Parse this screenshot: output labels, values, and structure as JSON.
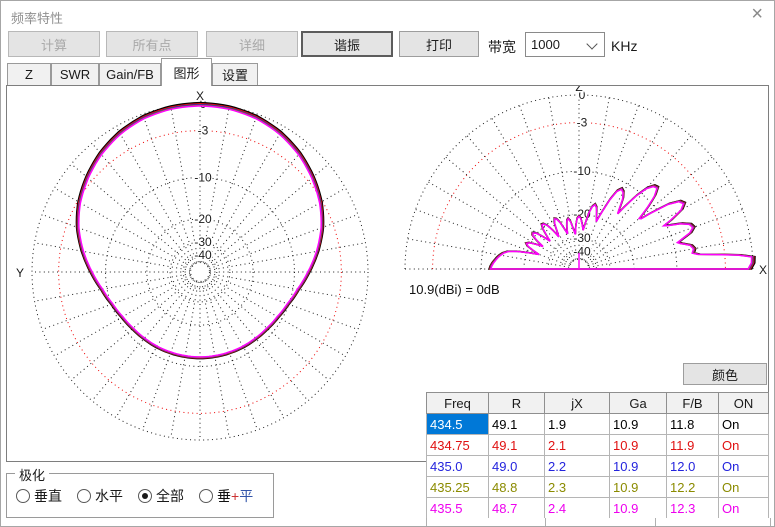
{
  "window": {
    "title": "频率特性",
    "close_icon": "×"
  },
  "toolbar": {
    "buttons": [
      {
        "label": "计算",
        "enabled": false
      },
      {
        "label": "所有点",
        "enabled": false
      },
      {
        "label": "详细",
        "enabled": false
      },
      {
        "label": "谐振",
        "enabled": true,
        "emphasized": true
      },
      {
        "label": "打印",
        "enabled": true
      }
    ],
    "bandwidth": {
      "label": "带宽",
      "value": "1000",
      "unit": "KHz"
    }
  },
  "tabs": {
    "items": [
      "Z",
      "SWR",
      "Gain/FB",
      "图形",
      "设置"
    ],
    "active": "图形"
  },
  "charts": {
    "gain_ref_note": "10.9(dBi) = 0dB",
    "trace_colors": [
      "#000000",
      "#dd1111",
      "#2424cc",
      "#8b8b00",
      "#ff00ff"
    ],
    "trace_db_offsets": [
      0.34,
      0.22,
      0.12,
      0.05,
      0
    ],
    "grid": {
      "ring_dbs": [
        0,
        -3,
        -10,
        -20,
        -30,
        -40,
        -50
      ],
      "labeled_dbs": [
        0,
        -3,
        -10,
        -20,
        -30,
        -40
      ],
      "ring_labels": [
        "0",
        "-3",
        "-10",
        "-20",
        "-30",
        "-40"
      ],
      "highlight_db": -3,
      "ring_color": "#1a1a1a",
      "highlight_ring_color": "#ee0000",
      "spoke_step_deg": 10
    },
    "azimuth": {
      "axis_top_label": "X",
      "axis_left_label": "Y",
      "samples_deg_db": [
        [
          0,
          -0.2
        ],
        [
          10,
          -0.28
        ],
        [
          20,
          -0.5
        ],
        [
          30,
          -0.95
        ],
        [
          40,
          -1.6
        ],
        [
          50,
          -2.45
        ],
        [
          60,
          -3.4
        ],
        [
          70,
          -4.6
        ],
        [
          80,
          -6.1
        ],
        [
          90,
          -7.7
        ],
        [
          100,
          -9.2
        ],
        [
          110,
          -10.3
        ],
        [
          120,
          -11.0
        ],
        [
          130,
          -11.4
        ],
        [
          140,
          -11.6
        ],
        [
          150,
          -11.7
        ],
        [
          160,
          -11.8
        ],
        [
          170,
          -11.85
        ],
        [
          180,
          -11.85
        ]
      ]
    },
    "elevation": {
      "axis_top_label": "Z",
      "axis_right_label": "X",
      "samples_deg_db": [
        [
          0,
          -0.5
        ],
        [
          2,
          -0.15
        ],
        [
          4,
          -0.1
        ],
        [
          5,
          -1.5
        ],
        [
          6,
          -4
        ],
        [
          7,
          -6.5
        ],
        [
          8,
          -7.3
        ],
        [
          10,
          -7.0
        ],
        [
          12,
          -7.4
        ],
        [
          14,
          -8.8
        ],
        [
          15,
          -9.3
        ],
        [
          16,
          -8.6
        ],
        [
          18,
          -7.0
        ],
        [
          20,
          -6.3
        ],
        [
          22,
          -6.6
        ],
        [
          24,
          -7.8
        ],
        [
          26,
          -9.8
        ],
        [
          27,
          -10.5
        ],
        [
          28,
          -9.0
        ],
        [
          30,
          -6.8
        ],
        [
          32,
          -6.0
        ],
        [
          34,
          -6.4
        ],
        [
          36,
          -8.0
        ],
        [
          38,
          -11.5
        ],
        [
          39,
          -13.5
        ],
        [
          40,
          -13.8
        ],
        [
          42,
          -11.0
        ],
        [
          44,
          -8.8
        ],
        [
          46,
          -7.6
        ],
        [
          48,
          -7.8
        ],
        [
          50,
          -8.8
        ],
        [
          52,
          -11
        ],
        [
          54,
          -14.5
        ],
        [
          55,
          -16.5
        ],
        [
          56,
          -15.5
        ],
        [
          58,
          -13
        ],
        [
          60,
          -11.8
        ],
        [
          62,
          -11.4
        ],
        [
          64,
          -12.2
        ],
        [
          66,
          -14.5
        ],
        [
          68,
          -18
        ],
        [
          70,
          -21.5
        ],
        [
          72,
          -19.5
        ],
        [
          74,
          -17.5
        ],
        [
          76,
          -16.8
        ],
        [
          78,
          -17.5
        ],
        [
          80,
          -19.5
        ],
        [
          82,
          -23
        ],
        [
          84,
          -26
        ],
        [
          86,
          -23.5
        ],
        [
          88,
          -21.5
        ],
        [
          90,
          -20.8
        ],
        [
          92,
          -21.5
        ],
        [
          94,
          -24
        ],
        [
          96,
          -28
        ],
        [
          98,
          -25.5
        ],
        [
          100,
          -22.5
        ],
        [
          102,
          -21.2
        ],
        [
          104,
          -21.8
        ],
        [
          106,
          -24
        ],
        [
          108,
          -27
        ],
        [
          110,
          -24.5
        ],
        [
          112,
          -21.8
        ],
        [
          114,
          -20.2
        ],
        [
          116,
          -19.8
        ],
        [
          118,
          -21
        ],
        [
          120,
          -24
        ],
        [
          122,
          -26.5
        ],
        [
          124,
          -23
        ],
        [
          126,
          -20.5
        ],
        [
          128,
          -19.4
        ],
        [
          130,
          -19.2
        ],
        [
          132,
          -20.5
        ],
        [
          134,
          -23
        ],
        [
          136,
          -25.5
        ],
        [
          138,
          -22.5
        ],
        [
          140,
          -19.8
        ],
        [
          142,
          -19.0
        ],
        [
          144,
          -19.4
        ],
        [
          146,
          -21.5
        ],
        [
          148,
          -24.5
        ],
        [
          150,
          -22
        ],
        [
          152,
          -19.8
        ],
        [
          154,
          -19.0
        ],
        [
          156,
          -19.8
        ],
        [
          158,
          -22
        ],
        [
          160,
          -24.5
        ],
        [
          162,
          -21
        ],
        [
          164,
          -17.5
        ],
        [
          166,
          -15.2
        ],
        [
          168,
          -14.2
        ],
        [
          170,
          -13.6
        ],
        [
          172,
          -13.1
        ],
        [
          174,
          -12.7
        ],
        [
          176,
          -12.3
        ],
        [
          178,
          -12.0
        ],
        [
          180,
          -11.8
        ]
      ]
    }
  },
  "color_button": {
    "label": "颜色"
  },
  "freq_table": {
    "headers": [
      "Freq",
      "R",
      "jX",
      "Ga",
      "F/B",
      "ON"
    ],
    "selection_color": "#0078d7",
    "rows": [
      {
        "cells": [
          "434.5",
          "49.1",
          "1.9",
          "10.9",
          "11.8",
          "On"
        ],
        "color": "#000000",
        "selected_col": 0
      },
      {
        "cells": [
          "434.75",
          "49.1",
          "2.1",
          "10.9",
          "11.9",
          "On"
        ],
        "color": "#e01212"
      },
      {
        "cells": [
          "435.0",
          "49.0",
          "2.2",
          "10.9",
          "12.0",
          "On"
        ],
        "color": "#2424dd"
      },
      {
        "cells": [
          "435.25",
          "48.8",
          "2.3",
          "10.9",
          "12.2",
          "On"
        ],
        "color": "#8b8b00"
      },
      {
        "cells": [
          "435.5",
          "48.7",
          "2.4",
          "10.9",
          "12.3",
          "On"
        ],
        "color": "#ee00ee"
      }
    ]
  },
  "polarization": {
    "group_label": "极化",
    "options": [
      {
        "label": "垂直",
        "checked": false
      },
      {
        "label": "水平",
        "checked": false
      },
      {
        "label": "全部",
        "checked": true
      },
      {
        "label": "垂+平",
        "checked": false,
        "label_parts": [
          {
            "text": "垂",
            "color": "#111111"
          },
          {
            "text": "+",
            "color": "#cc3333"
          },
          {
            "text": "平",
            "color": "#3355aa"
          }
        ]
      }
    ]
  }
}
